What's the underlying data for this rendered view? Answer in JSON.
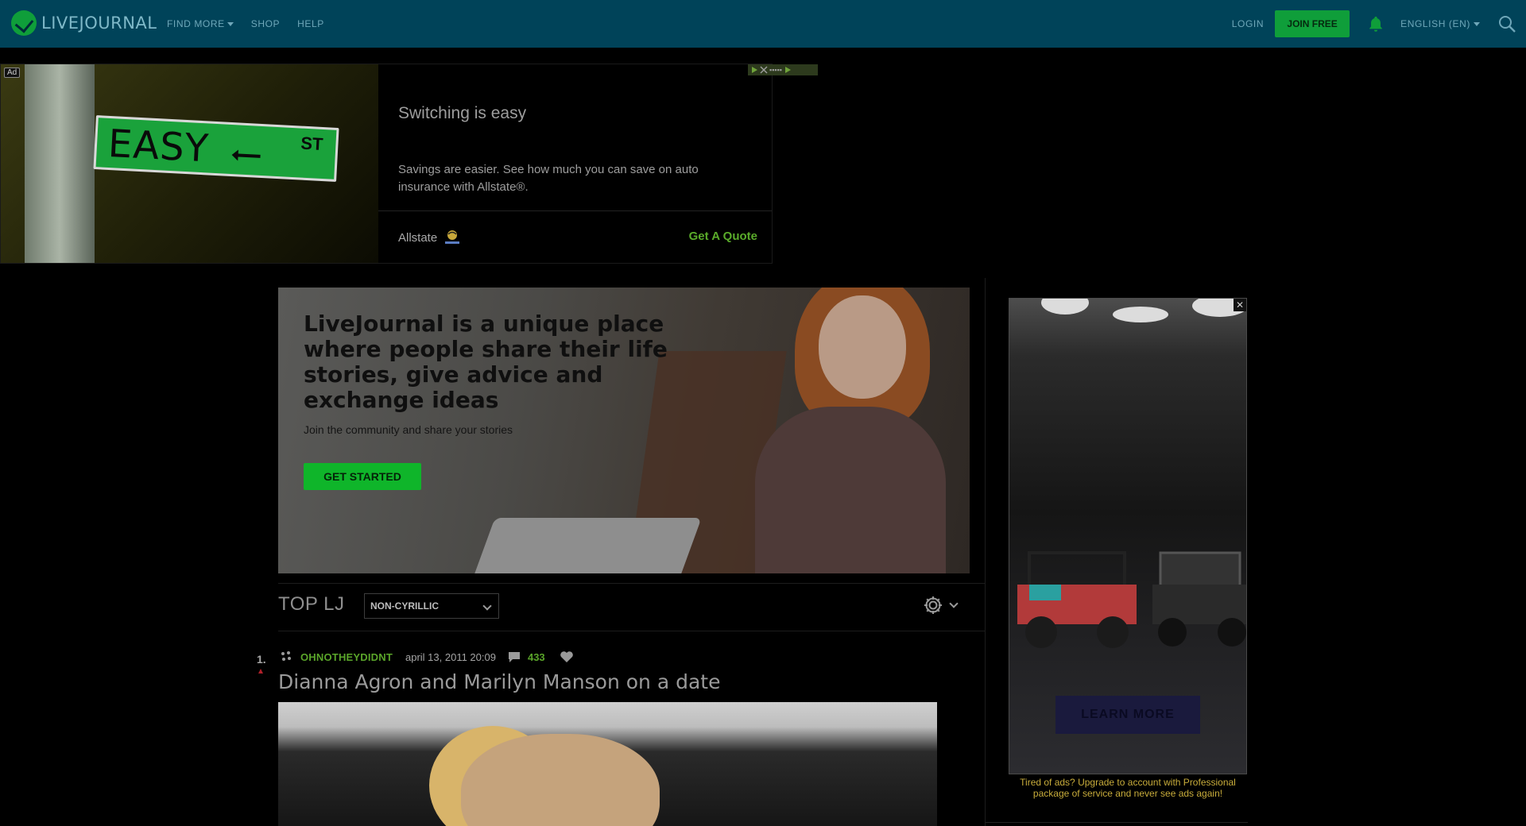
{
  "header": {
    "logo_text": "LIVEJOURNAL",
    "nav": [
      {
        "label": "FIND MORE",
        "has_caret": true
      },
      {
        "label": "SHOP",
        "has_caret": false
      },
      {
        "label": "HELP",
        "has_caret": false
      }
    ],
    "login_label": "LOGIN",
    "join_label": "JOIN FREE",
    "language_label": "ENGLISH (EN)",
    "icons": [
      "bell-icon",
      "search-icon"
    ]
  },
  "top_ad": {
    "badge": "Ad",
    "sign_word": "EASY",
    "sign_suffix": "ST",
    "title": "Switching is easy",
    "description": "Savings are easier. See how much you can save on auto insurance with Allstate®.",
    "brand": "Allstate",
    "cta": "Get A Quote"
  },
  "hero": {
    "heading": "LiveJournal is a unique place where people share their life stories, give advice and exchange ideas",
    "subtext": "Join the community and share your stories",
    "button_label": "GET STARTED"
  },
  "top_lj": {
    "title": "TOP LJ",
    "filter_selected": "NON-CYRILLIC"
  },
  "post": {
    "rank": "1.",
    "community": "OHNOTHEYDIDNT",
    "date": "april 13, 2011 20:09",
    "comment_count": "433",
    "title": "Dianna Agron and Marilyn Manson on a date"
  },
  "side_ad": {
    "cta": "LEARN MORE",
    "upgrade_text": "Tired of ads? Upgrade to account with Professional package of service and never see ads again!"
  },
  "colors": {
    "header_bg": "#004359",
    "accent_green": "#0f9e3a",
    "link_green": "#5aa52a",
    "upgrade_gold": "#c9ad3b"
  }
}
